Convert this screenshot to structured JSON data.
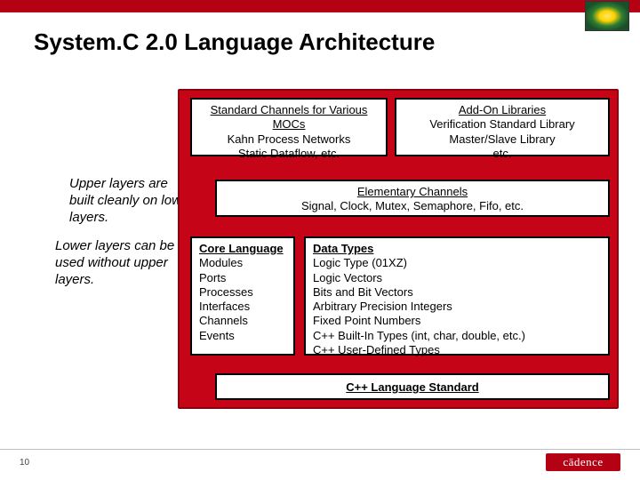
{
  "title": "System.C 2.0 Language Architecture",
  "page_number": "10",
  "footer_logo": "cādence",
  "notes": {
    "upper": "Upper layers are built cleanly on lower layers.",
    "lower": "Lower layers can be used without upper layers."
  },
  "boxes": {
    "std_channels": {
      "heading": "Standard Channels for Various MOCs",
      "line1": "Kahn Process Networks",
      "line2": "Static Dataflow, etc."
    },
    "addon": {
      "heading": "Add-On Libraries",
      "line1": "Verification Standard Library",
      "line2": "Master/Slave Library",
      "line3": "etc."
    },
    "elementary": {
      "heading": "Elementary Channels",
      "line1": "Signal, Clock, Mutex, Semaphore, Fifo, etc."
    },
    "core": {
      "heading": "Core Language",
      "items": [
        "Modules",
        "Ports",
        "Processes",
        "Interfaces",
        "Channels",
        "Events"
      ]
    },
    "datatypes": {
      "heading": "Data Types",
      "items": [
        "Logic Type (01XZ)",
        "Logic Vectors",
        "Bits and Bit Vectors",
        "Arbitrary Precision Integers",
        "Fixed Point Numbers",
        "C++ Built-In Types (int, char, double, etc.)",
        "C++ User-Defined Types"
      ]
    },
    "cpp": "C++ Language Standard"
  }
}
